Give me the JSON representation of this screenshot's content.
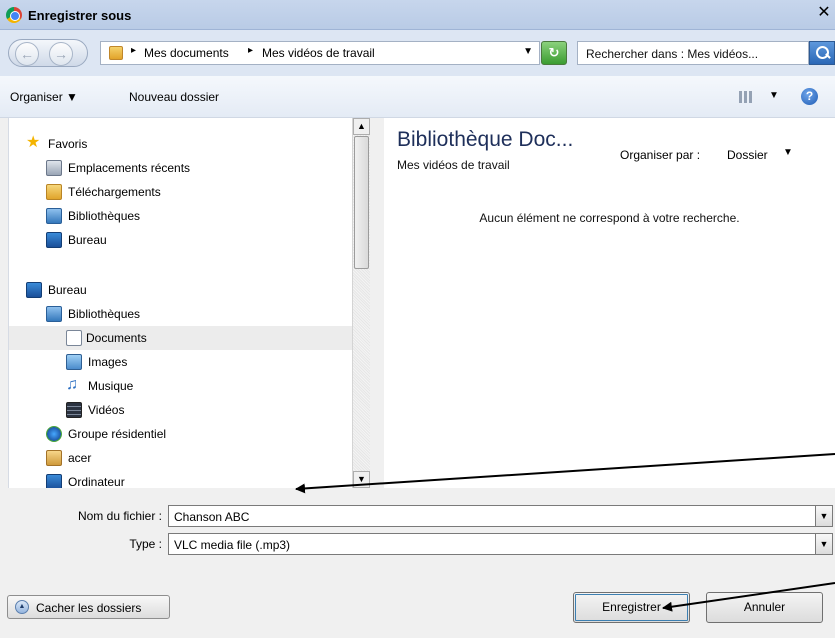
{
  "window": {
    "title": "Enregistrer sous",
    "close_glyph": "✕"
  },
  "address_bar": {
    "breadcrumbs": [
      "Mes documents",
      "Mes vidéos de travail"
    ],
    "search_placeholder": "Rechercher dans : Mes vidéos..."
  },
  "toolbar": {
    "organise_label": "Organiser",
    "new_folder_label": "Nouveau dossier"
  },
  "nav": {
    "items": [
      {
        "label": "Favoris",
        "icon": "star-icon"
      },
      {
        "label": "Emplacements récents",
        "icon": "recent-places-icon"
      },
      {
        "label": "Téléchargements",
        "icon": "downloads-icon"
      },
      {
        "label": "Bibliothèques",
        "icon": "libraries-icon"
      },
      {
        "label": "Bureau",
        "icon": "desktop-icon"
      },
      {
        "label": "Bureau",
        "icon": "desktop-icon"
      },
      {
        "label": "Bibliothèques",
        "icon": "libraries-icon"
      },
      {
        "label": "Documents",
        "icon": "document-icon",
        "selected": true
      },
      {
        "label": "Images",
        "icon": "images-icon"
      },
      {
        "label": "Musique",
        "icon": "music-icon"
      },
      {
        "label": "Vidéos",
        "icon": "video-icon"
      },
      {
        "label": "Groupe résidentiel",
        "icon": "homegroup-icon"
      },
      {
        "label": "acer",
        "icon": "user-folder-icon"
      },
      {
        "label": "Ordinateur",
        "icon": "computer-icon"
      }
    ]
  },
  "content": {
    "library_title": "Bibliothèque Doc...",
    "library_subtitle": "Mes vidéos de travail",
    "arrange_label": "Organiser par :",
    "arrange_value": "Dossier",
    "empty_message": "Aucun élément ne correspond à votre recherche."
  },
  "form": {
    "filename_label": "Nom du fichier :",
    "filename_value": "Chanson ABC",
    "type_label": "Type :",
    "type_value": "VLC media file (.mp3)",
    "hide_folders_label": "Cacher les dossiers",
    "save_label": "Enregistrer",
    "cancel_label": "Annuler"
  },
  "colors": {
    "title_bar": "#c7d6ec",
    "address_bar": "#dde6f3",
    "selected_row": "#ececec",
    "library_title": "#1e2f5a"
  }
}
